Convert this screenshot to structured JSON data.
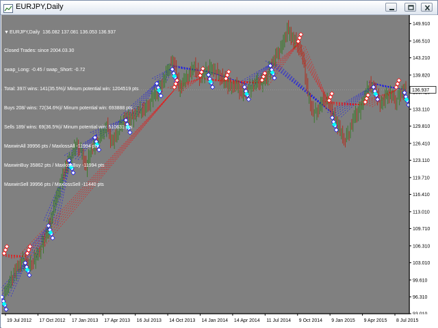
{
  "window": {
    "title": "EURJPY,Daily"
  },
  "info": {
    "header": "EURJPY,Daily  136.082 137.081 136.053 136.937",
    "lines": [
      "Closed Trades: since 2004.03.30",
      "swap_Long: -0.45 / swap_Short: -0.72",
      "Total: 397/ wins: 141(35.5%)/ Minum potential win: 1204519 pts",
      "Buys 208/ wins: 72(34.6%)/ Minum potential win: 693888 pts",
      "Sells 189/ wins: 69(36.5%)/ Minum potential win: 510631 pts",
      "MaxwinAll 39956 pts / MaxlossAll -11994 pts",
      "MaxwinBuy 35862 pts / MaxlossBuy -11994 pts",
      "MaxwinSell 39956 pts / MaxlossSell -11440 pts"
    ]
  },
  "colors": {
    "background": "#808080",
    "grid": "#a0a0a0",
    "bull": "#3a7a2a",
    "bear": "#b03020",
    "buy_line": "#0000ff",
    "sell_line": "#ff0000",
    "buy_marker": "#00ffff",
    "axis_text": "#000000"
  },
  "chart_data": {
    "type": "line",
    "symbol": "EURJPY",
    "timeframe": "Daily",
    "last_price": "136.937",
    "x_tick_labels": [
      "19 Jul 2012",
      "17 Oct 2012",
      "17 Jan 2013",
      "17 Apr 2013",
      "16 Jul 2013",
      "14 Oct 2013",
      "14 Jan 2014",
      "14 Apr 2014",
      "11 Jul 2014",
      "9 Oct 2014",
      "9 Jan 2015",
      "9 Apr 2015",
      "8 Jul 2015"
    ],
    "y_tick_labels": [
      "149.910",
      "146.510",
      "143.210",
      "139.820",
      "136.420",
      "133.110",
      "129.810",
      "126.410",
      "123.110",
      "119.710",
      "116.410",
      "113.010",
      "109.710",
      "106.310",
      "103.010",
      "99.610",
      "96.310",
      "93.010"
    ],
    "ylim": [
      93.01,
      151.6
    ],
    "x": [
      0,
      10,
      20,
      30,
      40,
      50,
      60,
      70,
      80,
      90,
      100,
      110,
      120,
      130,
      140,
      150,
      160,
      170,
      180,
      190,
      200,
      210,
      220,
      230,
      240,
      250,
      260,
      270,
      280,
      290,
      300,
      310,
      320,
      330,
      340,
      350,
      360,
      370,
      380,
      390,
      400,
      410,
      420,
      430,
      440,
      450,
      460,
      470,
      480,
      490,
      500,
      510,
      520,
      530,
      540,
      550,
      560,
      570,
      580,
      590,
      600,
      610,
      620,
      630,
      640,
      650,
      660,
      670,
      680,
      690,
      700,
      710,
      720,
      730,
      740,
      750,
      760,
      770,
      780
    ],
    "x_units": "trading days from 19 Jul 2012",
    "close": [
      96.8,
      98.5,
      100.9,
      102.7,
      103.5,
      102.3,
      103.6,
      105.4,
      107.9,
      110.8,
      114.8,
      118.2,
      121.9,
      123.6,
      126.2,
      124.9,
      121.6,
      125.3,
      126.4,
      128.1,
      129.7,
      126.6,
      128.4,
      130.8,
      131.5,
      131.3,
      132.7,
      133.0,
      133.8,
      135.6,
      136.7,
      138.7,
      141.5,
      142.6,
      137.1,
      138.6,
      139.9,
      141.7,
      139.2,
      140.4,
      141.1,
      140.8,
      139.6,
      138.6,
      137.3,
      137.8,
      136.6,
      136.5,
      137.5,
      138.4,
      138.3,
      139.4,
      142.2,
      143.9,
      145.4,
      148.7,
      147.0,
      145.9,
      143.4,
      135.9,
      132.2,
      133.0,
      135.2,
      134.3,
      131.7,
      129.5,
      127.1,
      128.8,
      131.9,
      132.8,
      135.7,
      138.0,
      137.0,
      133.8,
      135.5,
      136.2,
      134.6,
      136.4,
      136.9
    ],
    "series": [
      {
        "name": "Buy",
        "points": [
          [
            0,
            96.8
          ],
          [
            45,
            103.5
          ],
          [
            90,
            110.8
          ],
          [
            130,
            123.6
          ],
          [
            180,
            128.1
          ],
          [
            240,
            131.5
          ],
          [
            300,
            138.7
          ],
          [
            330,
            141.5
          ],
          [
            400,
            140.4
          ],
          [
            470,
            138.0
          ],
          [
            520,
            142.2
          ],
          [
            640,
            132.0
          ],
          [
            720,
            138.0
          ],
          [
            780,
            136.9
          ]
        ]
      },
      {
        "name": "Sell",
        "points": [
          [
            0,
            104.3
          ],
          [
            45,
            104.3
          ],
          [
            330,
            136.9
          ],
          [
            380,
            139.2
          ],
          [
            430,
            138.6
          ],
          [
            500,
            138.3
          ],
          [
            570,
            145.9
          ],
          [
            630,
            134.3
          ],
          [
            700,
            134.0
          ],
          [
            760,
            136.9
          ]
        ]
      }
    ]
  }
}
